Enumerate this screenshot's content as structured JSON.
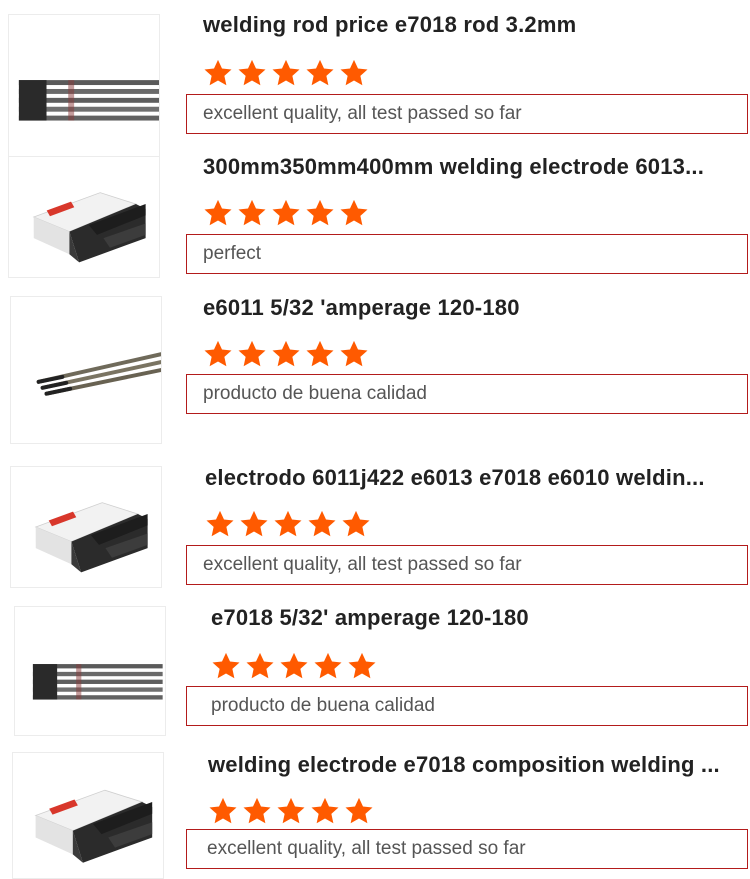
{
  "reviews": [
    {
      "product_title": "welding rod price e7018 rod 3.2mm",
      "rating": 5,
      "comment": "excellent quality, all test passed so far",
      "image_icon": "steel-rods-image"
    },
    {
      "product_title": "300mm350mm400mm welding electrode 6013...",
      "rating": 5,
      "comment": "perfect",
      "image_icon": "electrode-box-image"
    },
    {
      "product_title": "e6011 5/32 'amperage 120-180",
      "rating": 5,
      "comment": "producto de buena calidad",
      "image_icon": "diagonal-rods-image"
    },
    {
      "product_title": "electrodo 6011j422 e6013 e7018 e6010 weldin...",
      "rating": 5,
      "comment": "excellent quality, all test passed so far",
      "image_icon": "electrode-box-image"
    },
    {
      "product_title": "e7018 5/32' amperage 120-180",
      "rating": 5,
      "comment": "producto de buena calidad",
      "image_icon": "steel-rods-image"
    },
    {
      "product_title": "welding electrode e7018 composition welding ...",
      "rating": 5,
      "comment": "excellent quality, all test passed so far",
      "image_icon": "electrode-box-image"
    }
  ],
  "colors": {
    "star": "#ff5a00",
    "comment_border": "#b31b1b",
    "title": "#222222",
    "comment_text": "#555555"
  }
}
